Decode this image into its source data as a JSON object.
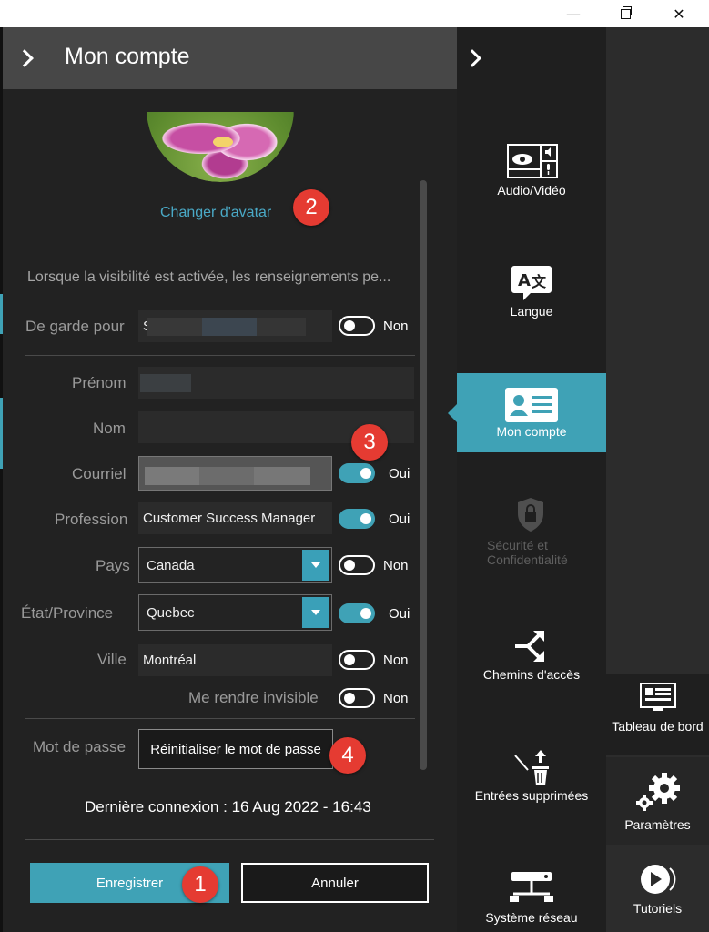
{
  "window": {
    "minimize_glyph": "—",
    "close_glyph": "✕"
  },
  "panel": {
    "title": "Mon compte",
    "change_avatar": "Changer d'avatar",
    "visibility_notice": "Lorsque la visibilité est activée, les renseignements pe...",
    "on_call": {
      "label": "De garde pour",
      "value": "S",
      "toggle": "Non",
      "toggle_on": false
    },
    "fields": {
      "first_name": {
        "label": "Prénom",
        "value": ""
      },
      "last_name": {
        "label": "Nom",
        "value": ""
      },
      "email": {
        "label": "Courriel",
        "value": "",
        "toggle": "Oui",
        "toggle_on": true
      },
      "profession": {
        "label": "Profession",
        "value": "Customer Success Manager",
        "toggle": "Oui",
        "toggle_on": true
      },
      "country": {
        "label": "Pays",
        "value": "Canada",
        "toggle": "Non",
        "toggle_on": false
      },
      "state": {
        "label": "État/Province",
        "value": "Quebec",
        "toggle": "Oui",
        "toggle_on": true
      },
      "city": {
        "label": "Ville",
        "value": "Montréal",
        "toggle": "Non",
        "toggle_on": false
      },
      "invisible": {
        "label": "Me rendre invisible",
        "toggle": "Non",
        "toggle_on": false
      }
    },
    "password": {
      "label": "Mot de passe",
      "button": "Réinitialiser le mot de passe"
    },
    "last_login": "Dernière connexion : 16 Aug 2022 - 16:43",
    "save": "Enregistrer",
    "cancel": "Annuler"
  },
  "callouts": [
    "1",
    "2",
    "3",
    "4"
  ],
  "nav": {
    "items": [
      {
        "label": "Audio/Vidéo",
        "icon": "audio-video-icon"
      },
      {
        "label": "Langue",
        "icon": "language-icon"
      },
      {
        "label": "Mon compte",
        "icon": "account-card-icon",
        "active": true
      },
      {
        "label": "Sécurité et Confidentialité",
        "icon": "lock-shield-icon",
        "disabled": true
      },
      {
        "label": "Chemins d'accès",
        "icon": "routing-icon"
      },
      {
        "label": "Entrées supprimées",
        "icon": "trash-icon"
      },
      {
        "label": "Système réseau",
        "icon": "network-icon"
      }
    ],
    "tiles": [
      {
        "label": "Tableau de bord",
        "icon": "dashboard-icon"
      },
      {
        "label": "Paramètres",
        "icon": "gears-icon"
      },
      {
        "label": "Tutoriels",
        "icon": "play-icon"
      }
    ]
  },
  "colors": {
    "accent": "#3fa2b6",
    "callout": "#e53b32",
    "link": "#4aa9c6"
  }
}
